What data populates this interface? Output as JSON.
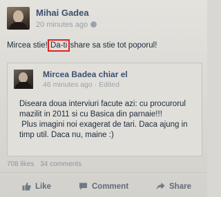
{
  "post": {
    "author": "Mihai Gadea",
    "time": "20 minutes ago",
    "text_before": "Mircea stie! ",
    "text_highlight": "Da-ti",
    "text_after": " share sa stie tot poporul!"
  },
  "shared_post": {
    "author": "Mircea Badea chiar el",
    "time": "46 minutes ago",
    "edited": "Edited",
    "text_lines": [
      "Diseara doua interviuri facute azi: cu procurorul",
      "mazilit in 2011 si cu Basica din parnaie!!!",
      " Plus imagini noi exagerat de tari. Daca ajung in",
      "timp util. Daca nu, maine :)"
    ]
  },
  "stats": {
    "likes": "708 likes",
    "comments": "34 comments"
  },
  "actions": {
    "like": "Like",
    "comment": "Comment",
    "share": "Share"
  },
  "colors": {
    "name": "#3b4f6e",
    "text": "#1d2a3a",
    "highlight": "#e02020"
  },
  "icons": {
    "privacy": "globe-icon",
    "like": "thumbs-up-icon",
    "comment": "comment-bubble-icon",
    "share": "share-arrow-icon"
  }
}
